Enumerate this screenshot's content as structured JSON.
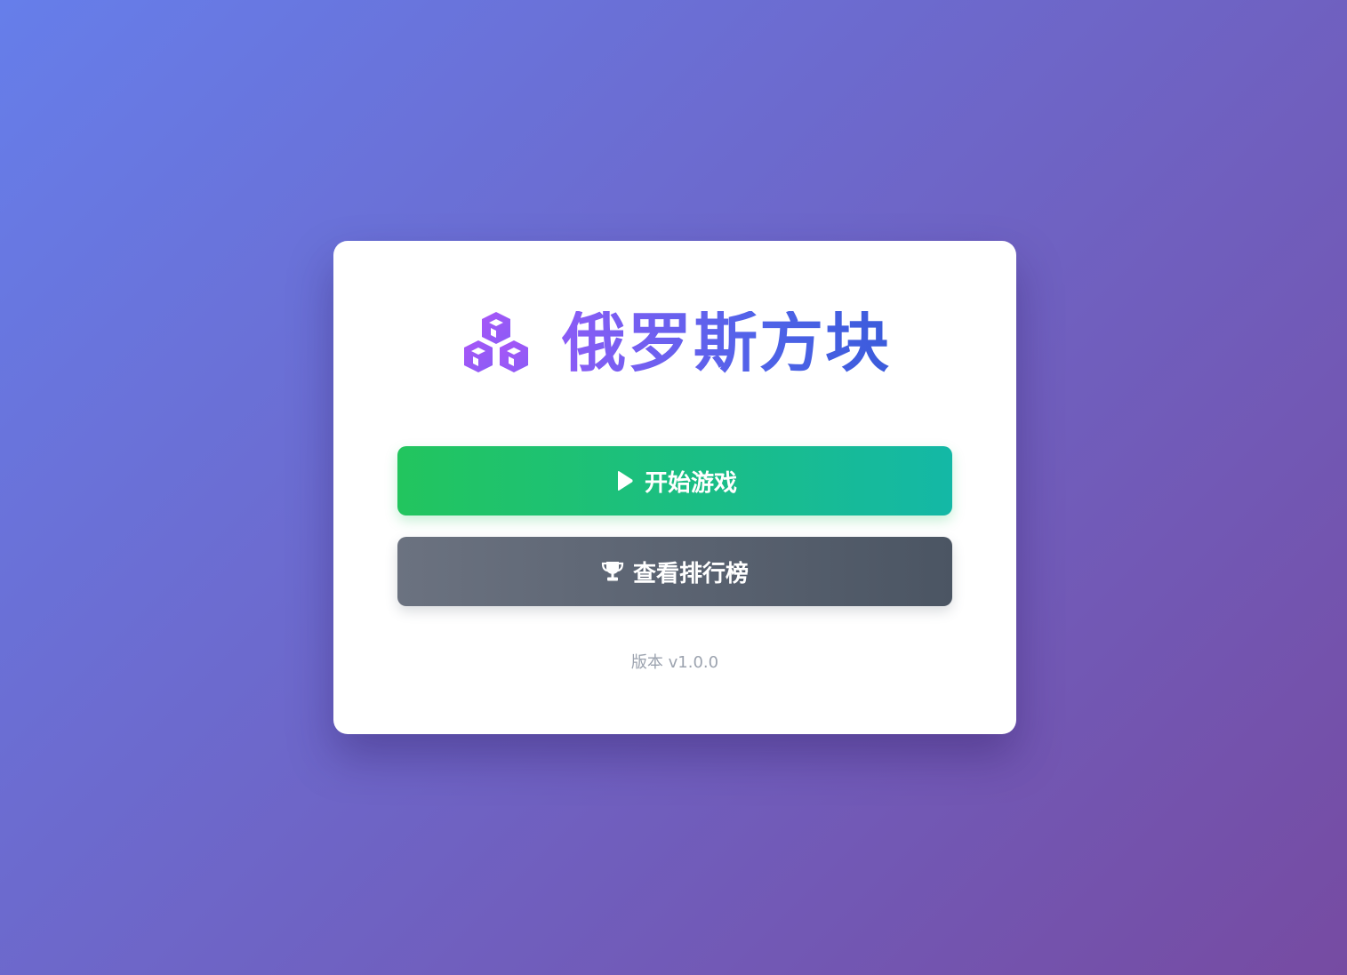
{
  "app": {
    "title": "俄罗斯方块",
    "logo_icon": "cubes-icon"
  },
  "menu": {
    "start_button": {
      "label": "开始游戏",
      "icon": "play-icon"
    },
    "leaderboard_button": {
      "label": "查看排行榜",
      "icon": "trophy-icon"
    }
  },
  "footer": {
    "version": "版本 v1.0.0"
  },
  "colors": {
    "background_start": "#667eea",
    "background_end": "#764ba2",
    "title_gradient_start": "#8b5cf6",
    "title_gradient_end": "#3b5bdb",
    "start_button_start": "#22c55e",
    "start_button_end": "#14b8a6",
    "leaderboard_button_start": "#6b7280",
    "leaderboard_button_end": "#4b5563",
    "version_text": "#9ca3af"
  }
}
